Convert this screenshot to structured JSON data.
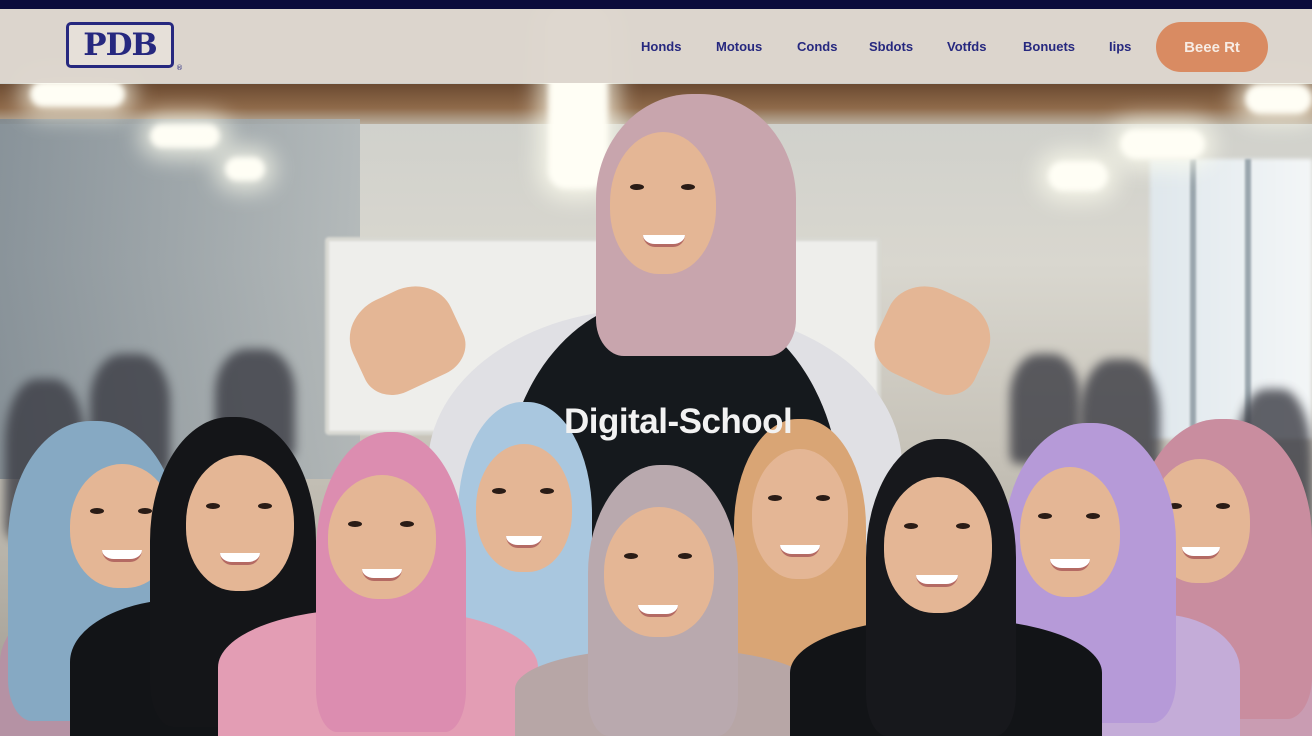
{
  "brand": {
    "logo_text": "PDB",
    "logo_mark": "®"
  },
  "nav": {
    "links": [
      "Honds",
      "Motous",
      "Conds",
      "Sbdots",
      "Votfds",
      "Bonuets",
      "Iips"
    ],
    "cta_label": "Beee Rt"
  },
  "hero": {
    "shirt_text": "Digital-School"
  },
  "colors": {
    "navbar_bg": "#ddd5cd",
    "brand_navy": "#26287f",
    "cta": "#d98b62",
    "top_strip": "#0b0b3b"
  }
}
